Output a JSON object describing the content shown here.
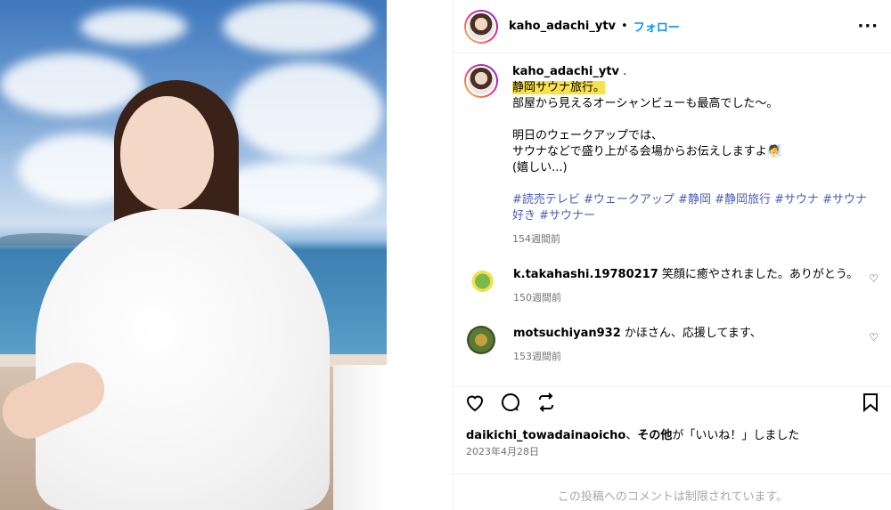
{
  "post": {
    "author": "kaho_adachi_ytv",
    "dot": "•",
    "follow_label": "フォロー",
    "more_label": "···"
  },
  "caption": {
    "author": "kaho_adachi_ytv",
    "suffix": ".",
    "highlight": "静岡サウナ旅行。",
    "line1": "部屋から見えるオーシャンビューも最高でした〜。",
    "line2": "明日のウェークアップでは、",
    "line3": "サウナなどで盛り上がる会場からお伝えしますよ🧖",
    "line4": "(嬉しい...)",
    "tags": "#読売テレビ #ウェークアップ #静岡 #静岡旅行 #サウナ #サウナ好き #サウナー",
    "time": "154週間前"
  },
  "comments": [
    {
      "user": "k.takahashi.19780217",
      "text": "笑顔に癒やされました。ありがとう。",
      "time": "150週間前"
    },
    {
      "user": "motsuchiyan932",
      "text": "かほさん、応援してます、",
      "time": "153週間前"
    }
  ],
  "actions": {
    "like_icon": "heart-icon",
    "comment_icon": "comment-icon",
    "share_icon": "repost-icon",
    "save_icon": "bookmark-icon"
  },
  "likes": {
    "user": "daikichi_towadainaoicho",
    "sep": "、",
    "others": "その他",
    "rest": "が「いいね！」しました"
  },
  "date": "2023年4月28日",
  "restricted": "この投稿へのコメントは制限されています。"
}
